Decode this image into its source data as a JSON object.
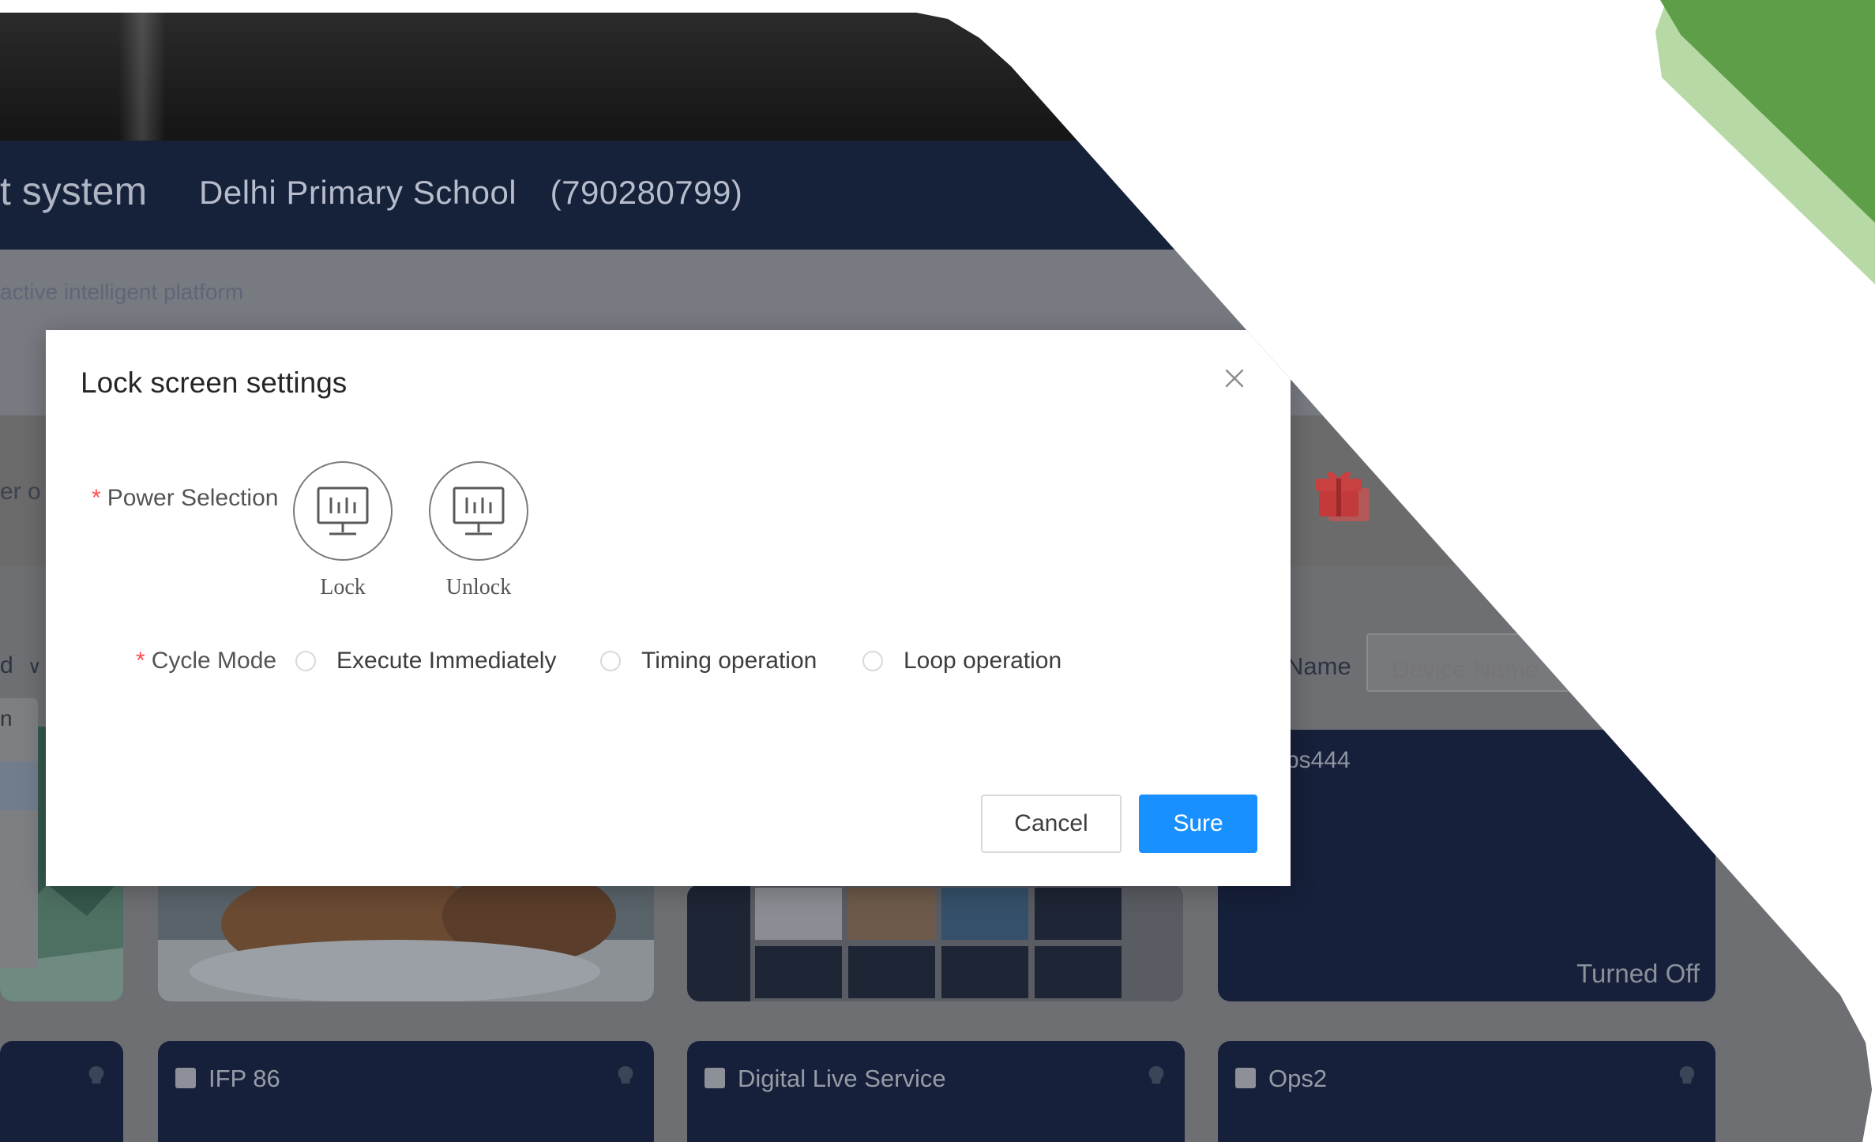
{
  "header": {
    "app_title_fragment": "t system",
    "school_name": "Delhi Primary School (790280799)",
    "platform_text": "active intelligent platform",
    "cutoff_text": "er o"
  },
  "filters": {
    "left_fragment": "d",
    "left_popup_fragment": "n",
    "device_name_label": "Name",
    "device_name_placeholder": "Device Name"
  },
  "devices": [
    {
      "id": "ps444",
      "status": "Turned Off"
    },
    {
      "name": "IFP 86"
    },
    {
      "name": "Digital Live Service"
    },
    {
      "name": "Ops2"
    }
  ],
  "modal": {
    "title": "Lock screen settings",
    "power_selection_label": "Power Selection",
    "power_options": [
      {
        "label": "Lock"
      },
      {
        "label": "Unlock"
      }
    ],
    "cycle_mode_label": "Cycle Mode",
    "cycle_options": [
      {
        "label": "Execute Immediately"
      },
      {
        "label": "Timing operation"
      },
      {
        "label": "Loop operation"
      }
    ],
    "cancel_label": "Cancel",
    "sure_label": "Sure"
  },
  "colors": {
    "primary": "#1890ff",
    "required": "#ff4d4f",
    "topbar": "#16213a",
    "tile": "#16203a",
    "accent_green": "#5fa04a"
  }
}
